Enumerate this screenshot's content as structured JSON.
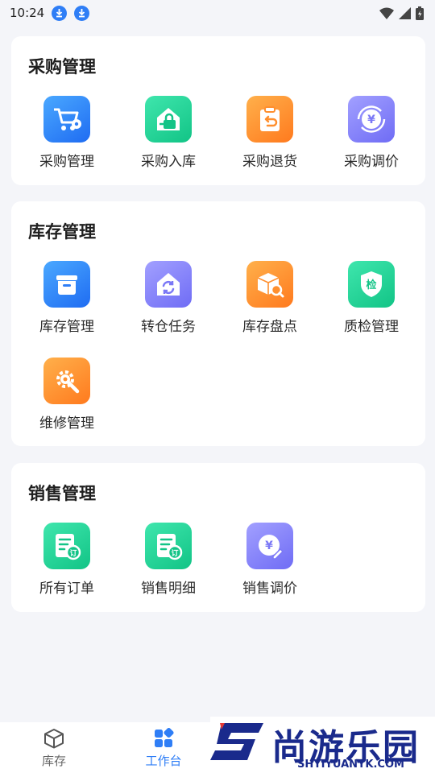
{
  "status_bar": {
    "time": "10:24"
  },
  "sections": [
    {
      "title": "采购管理",
      "items": [
        {
          "label": "采购管理",
          "icon": "cart-gear-icon"
        },
        {
          "label": "采购入库",
          "icon": "house-basket-icon"
        },
        {
          "label": "采购退货",
          "icon": "clipboard-return-icon"
        },
        {
          "label": "采购调价",
          "icon": "yen-cycle-icon"
        }
      ]
    },
    {
      "title": "库存管理",
      "items": [
        {
          "label": "库存管理",
          "icon": "inventory-box-icon"
        },
        {
          "label": "转仓任务",
          "icon": "warehouse-transfer-icon"
        },
        {
          "label": "库存盘点",
          "icon": "box-search-icon"
        },
        {
          "label": "质检管理",
          "icon": "shield-check-icon"
        },
        {
          "label": "维修管理",
          "icon": "wrench-gear-icon"
        }
      ]
    },
    {
      "title": "销售管理",
      "items": [
        {
          "label": "所有订单",
          "icon": "order-doc-icon"
        },
        {
          "label": "销售明细",
          "icon": "order-detail-icon"
        },
        {
          "label": "销售调价",
          "icon": "yen-edit-icon"
        }
      ]
    }
  ],
  "tabbar": {
    "tabs": [
      {
        "label": "库存",
        "icon": "cube-icon",
        "active": false
      },
      {
        "label": "工作台",
        "icon": "dashboard-grid-icon",
        "active": true
      }
    ]
  },
  "watermark": {
    "title": "尚游乐园",
    "url": "SHYIYUANYK.COM"
  },
  "colors": {
    "accent": "#2f7ef6",
    "tab_inactive": "#666666"
  }
}
